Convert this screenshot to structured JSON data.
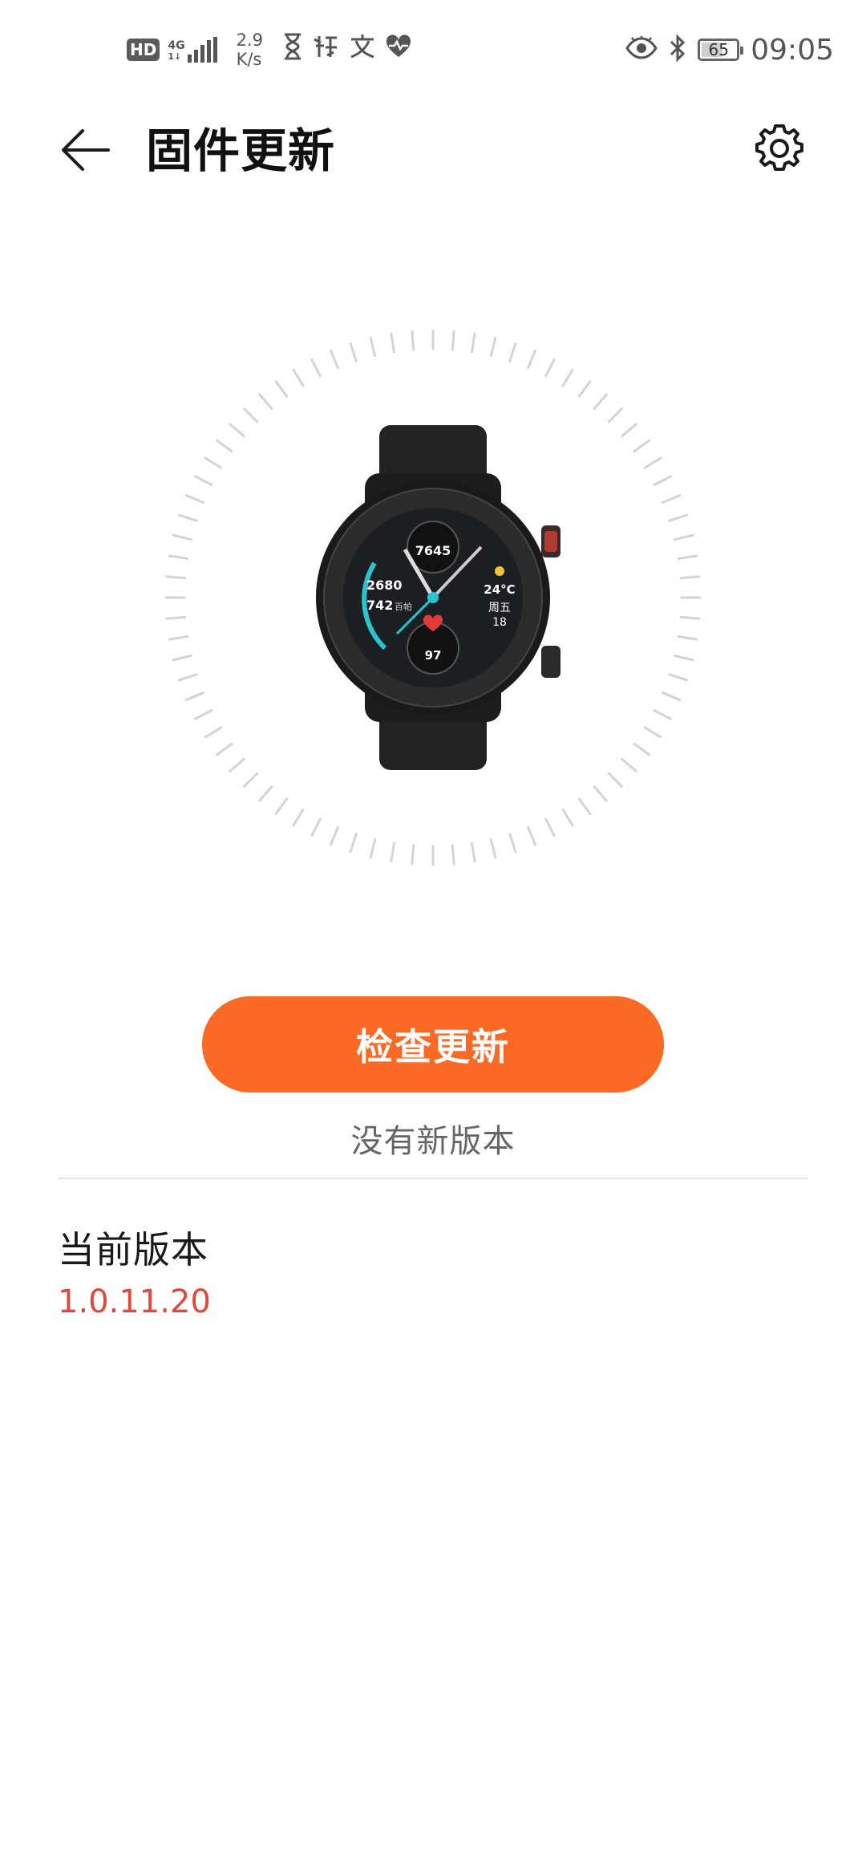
{
  "status_bar": {
    "hd_badge": "HD",
    "network_label": "4G",
    "network_sub_label": "1↓",
    "speed_value": "2.9",
    "speed_unit": "K/s",
    "battery_level": "65",
    "time": "09:05",
    "left_icons": [
      "hourglass-icon",
      "app-calligraphy-icon",
      "app-wen-icon",
      "health-heart-icon"
    ],
    "right_icons": [
      "eye-comfort-icon",
      "bluetooth-icon",
      "battery-icon"
    ]
  },
  "header": {
    "title": "固件更新",
    "back_icon": "back-arrow-icon",
    "settings_icon": "gear-icon"
  },
  "device_image": {
    "description_icon": "smartwatch-image",
    "watch_face": {
      "steps": "7645",
      "calories": "2680",
      "distance": "742",
      "distance_unit": "百帕",
      "temperature": "24°C",
      "weekday": "周五",
      "date": "18",
      "heart_rate": "97"
    }
  },
  "actions": {
    "check_update_label": "检查更新",
    "status_text": "没有新版本"
  },
  "version": {
    "label": "当前版本",
    "value": "1.0.11.20"
  },
  "colors": {
    "accent": "#fa6a25",
    "version_text": "#e0483c",
    "tick_color": "#d4d4d4"
  }
}
